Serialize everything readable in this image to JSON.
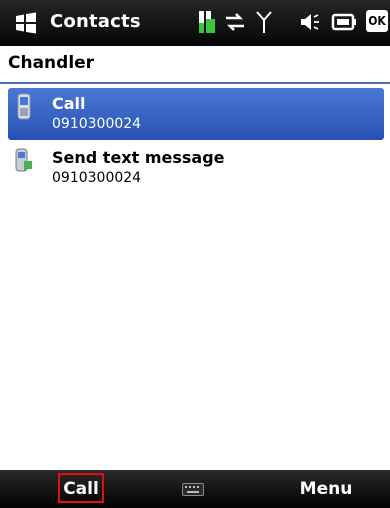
{
  "title_bar": {
    "app_title": "Contacts",
    "ok_label": "OK",
    "icons": [
      "windows-start-icon",
      "battery-charging-icon",
      "data-sync-icon",
      "signal-icon",
      "speaker-icon",
      "battery-icon"
    ]
  },
  "contact": {
    "name": "Chandler"
  },
  "actions": [
    {
      "label": "Call",
      "number": "0910300024",
      "icon": "phone-icon",
      "selected": true
    },
    {
      "label": "Send text message",
      "number": "0910300024",
      "icon": "sms-icon",
      "selected": false
    }
  ],
  "softkeys": {
    "left_label": "Call",
    "right_label": "Menu",
    "center_icon": "keyboard-icon"
  },
  "colors": {
    "selection": "#3563c4",
    "title_bar": "#111111",
    "focus_outline": "#e01010"
  }
}
